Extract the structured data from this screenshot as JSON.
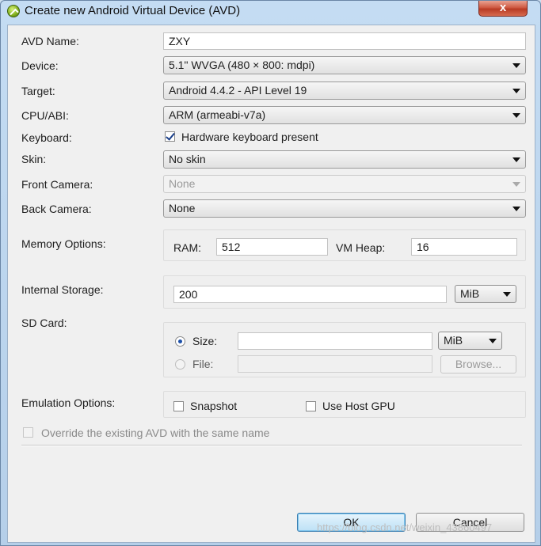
{
  "window": {
    "title": "Create new Android Virtual Device (AVD)",
    "close_glyph": "x"
  },
  "form": {
    "avd_name": {
      "label": "AVD Name:",
      "value": "ZXY"
    },
    "device": {
      "label": "Device:",
      "value": "5.1\" WVGA (480 × 800: mdpi)"
    },
    "target": {
      "label": "Target:",
      "value": "Android 4.4.2 - API Level 19"
    },
    "cpu_abi": {
      "label": "CPU/ABI:",
      "value": "ARM (armeabi-v7a)"
    },
    "keyboard": {
      "label": "Keyboard:",
      "checkbox_label": "Hardware keyboard present",
      "checked": true
    },
    "skin": {
      "label": "Skin:",
      "value": "No skin"
    },
    "front_camera": {
      "label": "Front Camera:",
      "value": "None"
    },
    "back_camera": {
      "label": "Back Camera:",
      "value": "None"
    },
    "memory": {
      "label": "Memory Options:",
      "ram_label": "RAM:",
      "ram_value": "512",
      "vm_heap_label": "VM Heap:",
      "vm_heap_value": "16"
    },
    "internal_storage": {
      "label": "Internal Storage:",
      "value": "200",
      "unit": "MiB"
    },
    "sd_card": {
      "label": "SD Card:",
      "size_label": "Size:",
      "size_value": "",
      "size_unit": "MiB",
      "file_label": "File:",
      "file_value": "",
      "browse_label": "Browse..."
    },
    "emulation": {
      "label": "Emulation Options:",
      "snapshot_label": "Snapshot",
      "host_gpu_label": "Use Host GPU"
    },
    "override": {
      "label": "Override the existing AVD with the same name"
    }
  },
  "buttons": {
    "ok": "OK",
    "cancel": "Cancel"
  },
  "watermark": "https://blog.csdn.net/weixin_43860497",
  "colors": {
    "title_bar": "#c4dcf3",
    "close_button": "#c94a34",
    "default_button": "#bde1f6"
  }
}
